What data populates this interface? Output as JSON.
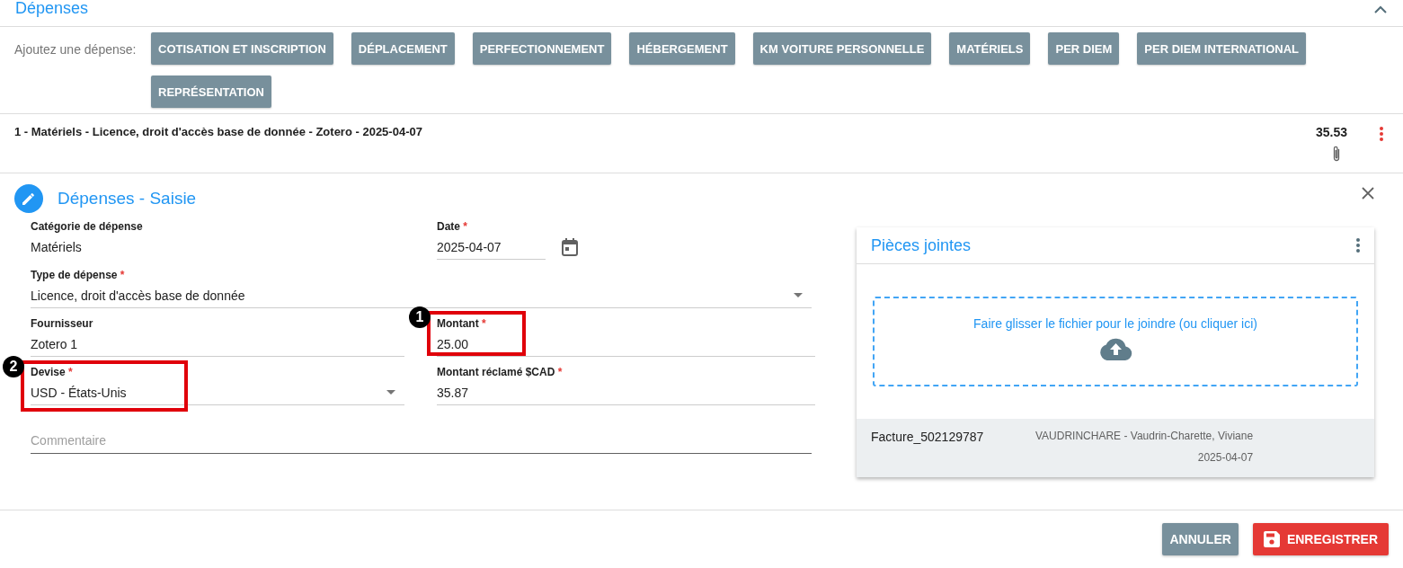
{
  "section": {
    "title": "Dépenses"
  },
  "add_bar": {
    "label": "Ajoutez une dépense:",
    "buttons": [
      "COTISATION ET INSCRIPTION",
      "DÉPLACEMENT",
      "PERFECTIONNEMENT",
      "HÉBERGEMENT",
      "KM VOITURE PERSONNELLE",
      "MATÉRIELS",
      "PER DIEM",
      "PER DIEM INTERNATIONAL",
      "REPRÉSENTATION"
    ]
  },
  "expenses": [
    {
      "title": "1 - Matériels - Licence, droit d'accès base de donnée - Zotero - 2025-04-07",
      "amount": "35.53",
      "has_attachment": true
    }
  ],
  "form": {
    "title": "Dépenses - Saisie",
    "rows": [
      [
        {
          "kind": "static",
          "label": "Catégorie de dépense",
          "value": "Matériels"
        },
        {
          "kind": "date",
          "label": "Date",
          "required_mark": "*",
          "value": "2025-04-07"
        }
      ],
      [
        {
          "kind": "select",
          "label": "Type de dépense",
          "required_mark": "*",
          "value": "Licence, droit d'accès base de donnée"
        }
      ],
      [
        {
          "kind": "text",
          "label": "Fournisseur",
          "value": "Zotero 1"
        },
        {
          "kind": "text",
          "label": "Montant",
          "required_mark": "*",
          "value": "25.00",
          "annotation": "1"
        }
      ],
      [
        {
          "kind": "select",
          "label": "Devise",
          "required_mark": "*",
          "value": "USD - États-Unis",
          "annotation": "2"
        },
        {
          "kind": "text",
          "label": "Montant réclamé $CAD",
          "required_mark": "*",
          "value": "35.87"
        }
      ],
      [
        {
          "kind": "placeholder",
          "placeholder": "Commentaire",
          "focused": true
        }
      ]
    ]
  },
  "attachments": {
    "title": "Pièces jointes",
    "drop_text": "Faire glisser le fichier pour le joindre (ou cliquer ici)",
    "files": [
      {
        "name": "Facture_502129787",
        "uploader": "VAUDRINCHARE - Vaudrin-Charette, Viviane",
        "date": "2025-04-07"
      }
    ]
  },
  "actions": [
    {
      "kind": "cancel",
      "label": "ANNULER"
    },
    {
      "kind": "save",
      "label": "ENREGISTRER"
    }
  ]
}
